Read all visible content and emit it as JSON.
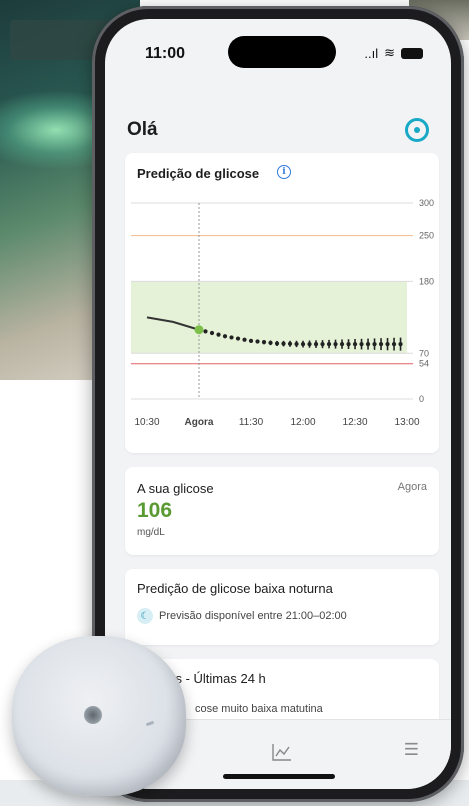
{
  "status_bar": {
    "time": "11:00",
    "signal": "..ıl",
    "wifi": "≋"
  },
  "header": {
    "greeting": "Olá"
  },
  "prediction_chart": {
    "title": "Predição de glicose",
    "range_color": "#e5f2d8",
    "high_line_color": "#f2b88a",
    "low_line_color": "#e06060",
    "observed_color": "#333333",
    "now_marker_color": "#7cbf4a"
  },
  "chart_data": {
    "type": "line",
    "title": "Predição de glicose",
    "x_categories": [
      "10:30",
      "Agora",
      "11:30",
      "12:00",
      "12:30",
      "13:00"
    ],
    "xlabel": "",
    "ylabel": "",
    "ylim": [
      0,
      300
    ],
    "y_ticks": [
      300,
      250,
      180,
      70,
      54,
      0
    ],
    "target_range": [
      70,
      180
    ],
    "threshold_lines": [
      250,
      54
    ],
    "series": [
      {
        "x": [
          0,
          0.5,
          1
        ],
        "y": [
          125,
          118,
          106
        ]
      },
      {
        "x": [
          1,
          1.5,
          2,
          2.5,
          3,
          3.5,
          4,
          4.5,
          5
        ],
        "y": [
          106,
          96,
          89,
          85,
          84,
          84,
          84,
          84,
          84
        ]
      }
    ],
    "grid": true,
    "legend": "none"
  },
  "glucose_card": {
    "label": "A sua glicose",
    "time": "Agora",
    "value": "106",
    "unit": "mg/dL"
  },
  "nocturnal_card": {
    "title": "Predição de glicose baixa noturna",
    "text": "Previsão disponível entre 21:00–02:00"
  },
  "notifications_card": {
    "title": "ões - Últimas 24 h",
    "subtitle": "cose muito baixa matutina"
  }
}
